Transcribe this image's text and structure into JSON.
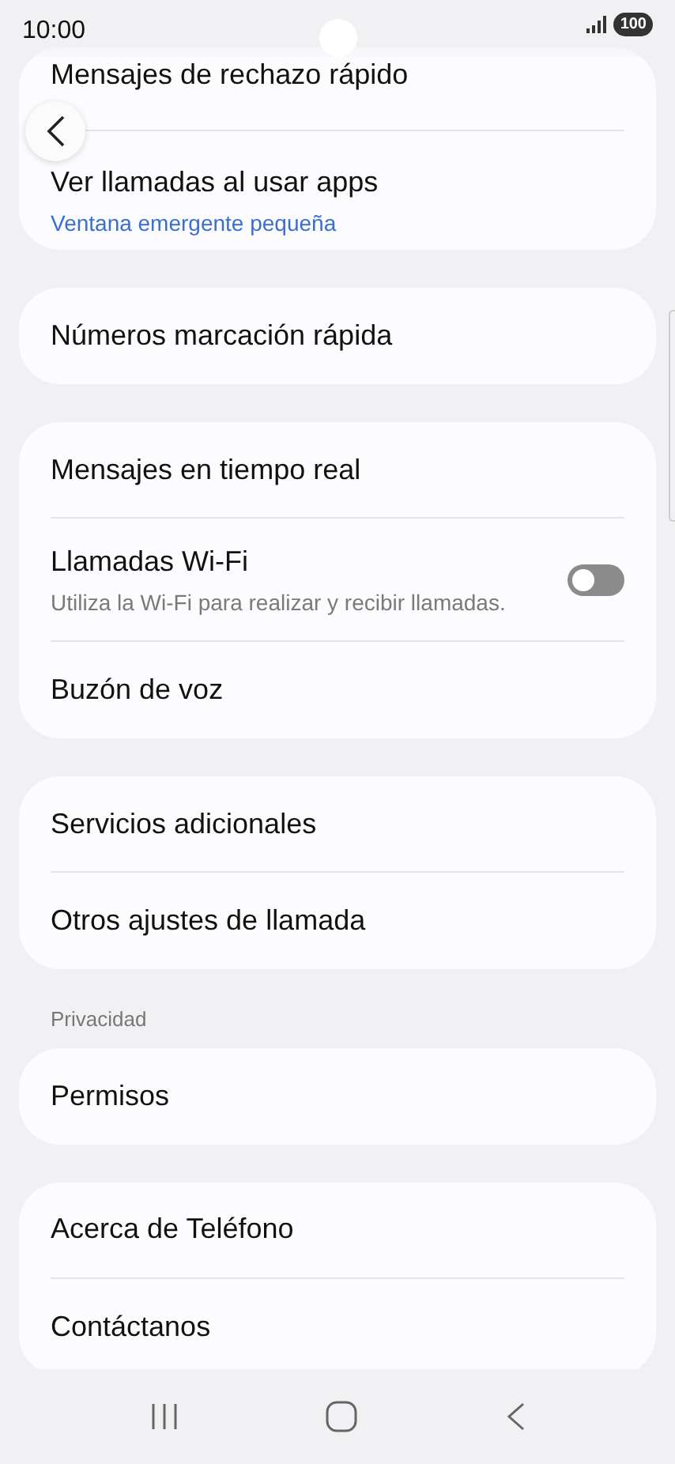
{
  "status_bar": {
    "time": "10:00",
    "battery": "100"
  },
  "groups": [
    {
      "items": [
        {
          "kind": "plain",
          "title": "Mensajes de rechazo rápido"
        },
        {
          "kind": "value",
          "title": "Ver llamadas al usar apps",
          "subtitle": "Ventana emergente pequeña"
        }
      ]
    },
    {
      "items": [
        {
          "kind": "plain",
          "title": "Números marcación rápida"
        }
      ]
    },
    {
      "items": [
        {
          "kind": "plain",
          "title": "Mensajes en tiempo real"
        },
        {
          "kind": "toggle",
          "title": "Llamadas Wi-Fi",
          "subtitle": "Utiliza la Wi-Fi para realizar y recibir llamadas.",
          "on": false
        },
        {
          "kind": "plain",
          "title": "Buzón de voz"
        }
      ]
    },
    {
      "items": [
        {
          "kind": "plain",
          "title": "Servicios adicionales"
        },
        {
          "kind": "plain",
          "title": "Otros ajustes de llamada"
        }
      ]
    },
    {
      "header": "Privacidad",
      "items": [
        {
          "kind": "plain",
          "title": "Permisos"
        }
      ]
    },
    {
      "items": [
        {
          "kind": "plain",
          "title": "Acerca de Teléfono"
        },
        {
          "kind": "plain",
          "title": "Contáctanos"
        }
      ]
    }
  ]
}
